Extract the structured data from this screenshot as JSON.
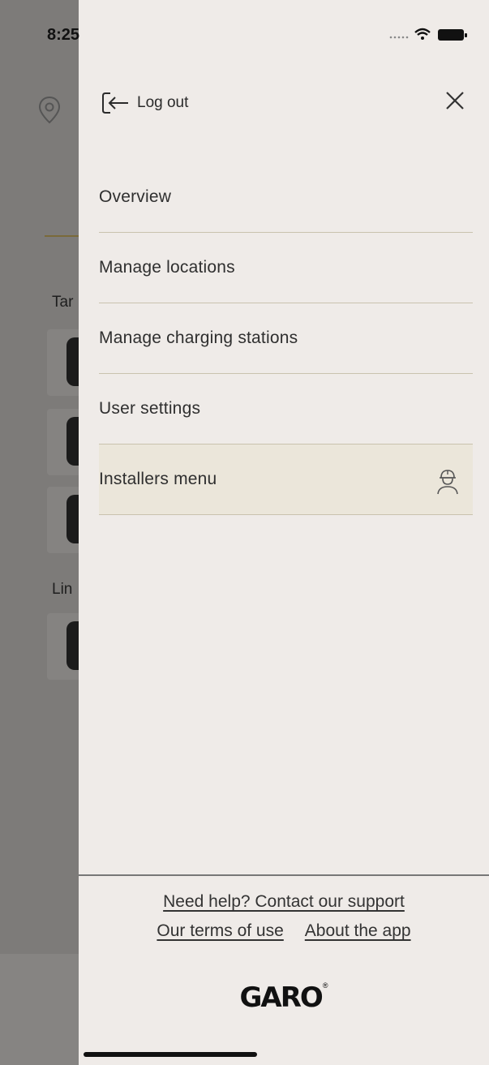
{
  "status_bar": {
    "time": "8:25"
  },
  "background": {
    "section_a": "Tar",
    "section_b": "Lin"
  },
  "drawer": {
    "logout_label": "Log out",
    "menu": [
      {
        "label": "Overview"
      },
      {
        "label": "Manage locations"
      },
      {
        "label": "Manage charging stations"
      },
      {
        "label": "User settings"
      },
      {
        "label": "Installers menu",
        "icon": "installer-helmet-icon"
      }
    ],
    "footer": {
      "support_link": "Need help? Contact our support",
      "terms_link": "Our terms of use",
      "about_link": "About the app"
    },
    "brand": "GARO"
  },
  "colors": {
    "drawer_bg": "#efebe8",
    "divider": "#c9c2ae",
    "highlight_bg": "#ebe6da",
    "overlay": "#7d7b79"
  }
}
